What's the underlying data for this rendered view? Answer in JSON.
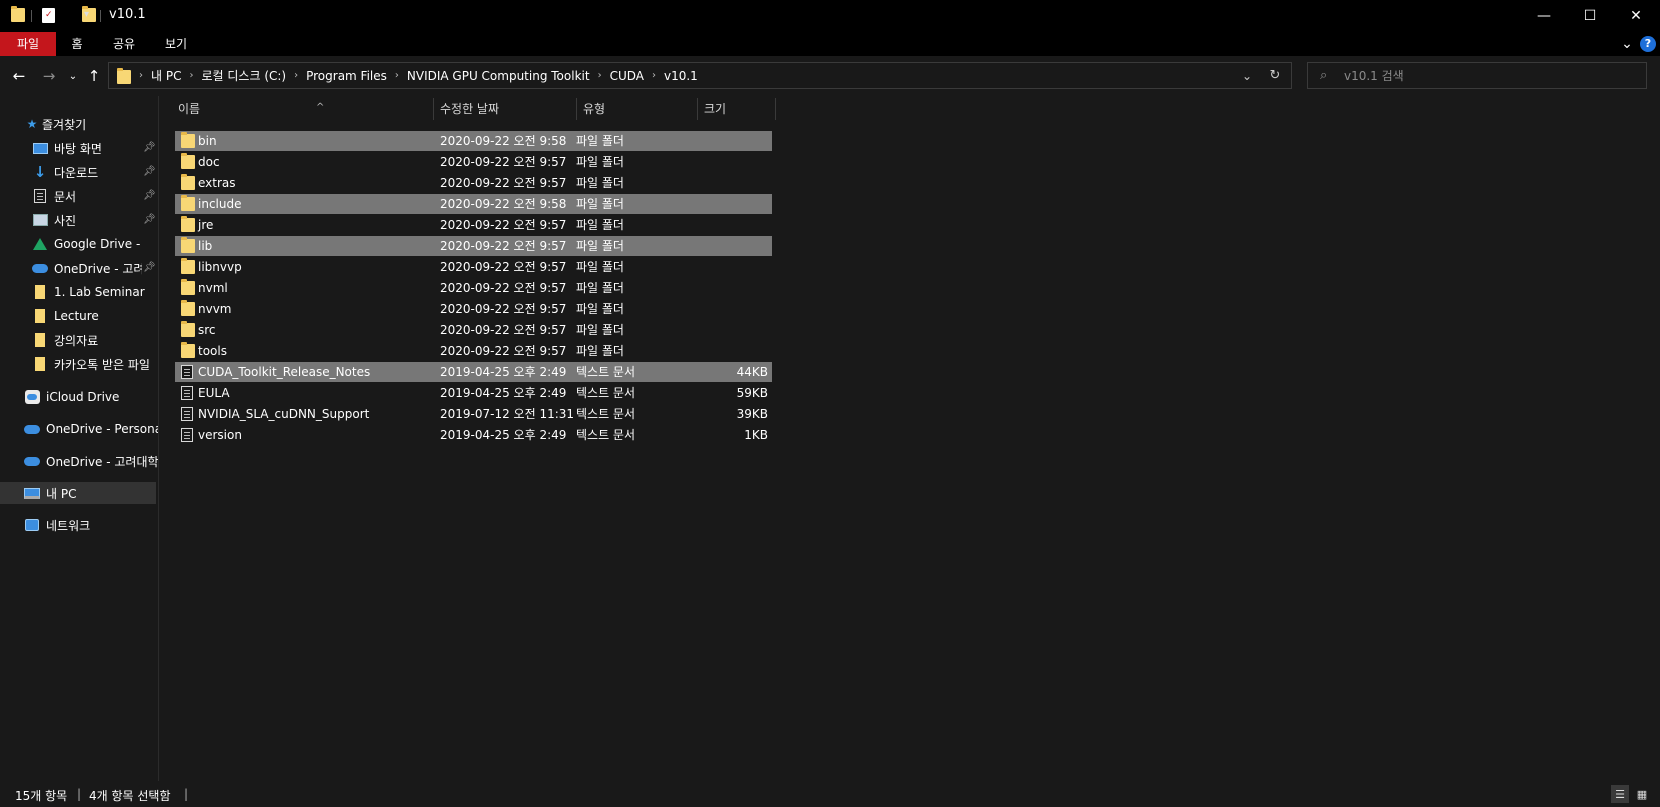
{
  "window": {
    "title": "v10.1",
    "minimize": "—",
    "maximize": "☐",
    "close": "✕"
  },
  "ribbon": {
    "tabs": [
      {
        "label": "파일"
      },
      {
        "label": "홈"
      },
      {
        "label": "공유"
      },
      {
        "label": "보기"
      }
    ],
    "expand_icon": "⌄",
    "help_icon": "?"
  },
  "address": {
    "breadcrumbs": [
      "내 PC",
      "로컬 디스크 (C:)",
      "Program Files",
      "NVIDIA GPU Computing Toolkit",
      "CUDA",
      "v10.1"
    ],
    "search_placeholder": "v10.1 검색"
  },
  "sidebar": {
    "quick_access": "즐겨찾기",
    "items": [
      {
        "label": "바탕 화면",
        "icon": "desktop-icon",
        "pinned": true
      },
      {
        "label": "다운로드",
        "icon": "download-icon",
        "pinned": true
      },
      {
        "label": "문서",
        "icon": "document-icon",
        "pinned": true
      },
      {
        "label": "사진",
        "icon": "pictures-icon",
        "pinned": true
      },
      {
        "label": "Google Drive - P",
        "icon": "google-drive-icon",
        "pinned": false
      },
      {
        "label": "OneDrive - 고려대",
        "icon": "onedrive-icon",
        "pinned": true
      },
      {
        "label": "1. Lab Seminar",
        "icon": "folder-icon",
        "pinned": false
      },
      {
        "label": "Lecture",
        "icon": "folder-icon",
        "pinned": false
      },
      {
        "label": "강의자료",
        "icon": "folder-icon",
        "pinned": false
      },
      {
        "label": "카카오톡 받은 파일",
        "icon": "folder-icon",
        "pinned": false
      }
    ],
    "roots": [
      {
        "label": "iCloud Drive",
        "icon": "icloud-icon"
      },
      {
        "label": "OneDrive - Personal",
        "icon": "onedrive-icon"
      },
      {
        "label": "OneDrive - 고려대학교",
        "icon": "onedrive-icon"
      },
      {
        "label": "내 PC",
        "icon": "pc-icon"
      },
      {
        "label": "네트워크",
        "icon": "network-icon"
      }
    ]
  },
  "columns": {
    "name": "이름",
    "date": "수정한 날짜",
    "type": "유형",
    "size": "크기"
  },
  "files": [
    {
      "name": "bin",
      "date": "2020-09-22 오전 9:58",
      "type": "파일 폴더",
      "size": "",
      "kind": "folder",
      "selected": true
    },
    {
      "name": "doc",
      "date": "2020-09-22 오전 9:57",
      "type": "파일 폴더",
      "size": "",
      "kind": "folder",
      "selected": false
    },
    {
      "name": "extras",
      "date": "2020-09-22 오전 9:57",
      "type": "파일 폴더",
      "size": "",
      "kind": "folder",
      "selected": false
    },
    {
      "name": "include",
      "date": "2020-09-22 오전 9:58",
      "type": "파일 폴더",
      "size": "",
      "kind": "folder",
      "selected": true
    },
    {
      "name": "jre",
      "date": "2020-09-22 오전 9:57",
      "type": "파일 폴더",
      "size": "",
      "kind": "folder",
      "selected": false
    },
    {
      "name": "lib",
      "date": "2020-09-22 오전 9:57",
      "type": "파일 폴더",
      "size": "",
      "kind": "folder",
      "selected": true
    },
    {
      "name": "libnvvp",
      "date": "2020-09-22 오전 9:57",
      "type": "파일 폴더",
      "size": "",
      "kind": "folder",
      "selected": false
    },
    {
      "name": "nvml",
      "date": "2020-09-22 오전 9:57",
      "type": "파일 폴더",
      "size": "",
      "kind": "folder",
      "selected": false
    },
    {
      "name": "nvvm",
      "date": "2020-09-22 오전 9:57",
      "type": "파일 폴더",
      "size": "",
      "kind": "folder",
      "selected": false
    },
    {
      "name": "src",
      "date": "2020-09-22 오전 9:57",
      "type": "파일 폴더",
      "size": "",
      "kind": "folder",
      "selected": false
    },
    {
      "name": "tools",
      "date": "2020-09-22 오전 9:57",
      "type": "파일 폴더",
      "size": "",
      "kind": "folder",
      "selected": false
    },
    {
      "name": "CUDA_Toolkit_Release_Notes",
      "date": "2019-04-25 오후 2:49",
      "type": "텍스트 문서",
      "size": "44KB",
      "kind": "text",
      "selected": true
    },
    {
      "name": "EULA",
      "date": "2019-04-25 오후 2:49",
      "type": "텍스트 문서",
      "size": "59KB",
      "kind": "text",
      "selected": false
    },
    {
      "name": "NVIDIA_SLA_cuDNN_Support",
      "date": "2019-07-12 오전 11:31",
      "type": "텍스트 문서",
      "size": "39KB",
      "kind": "text",
      "selected": false
    },
    {
      "name": "version",
      "date": "2019-04-25 오후 2:49",
      "type": "텍스트 문서",
      "size": "1KB",
      "kind": "text",
      "selected": false
    }
  ],
  "status": {
    "item_count": "15개 항목",
    "selected_count": "4개 항목 선택함"
  },
  "colors": {
    "file_tab": "#c4161c",
    "background": "#191919",
    "selection": "#777777",
    "folder": "#f8d775"
  }
}
